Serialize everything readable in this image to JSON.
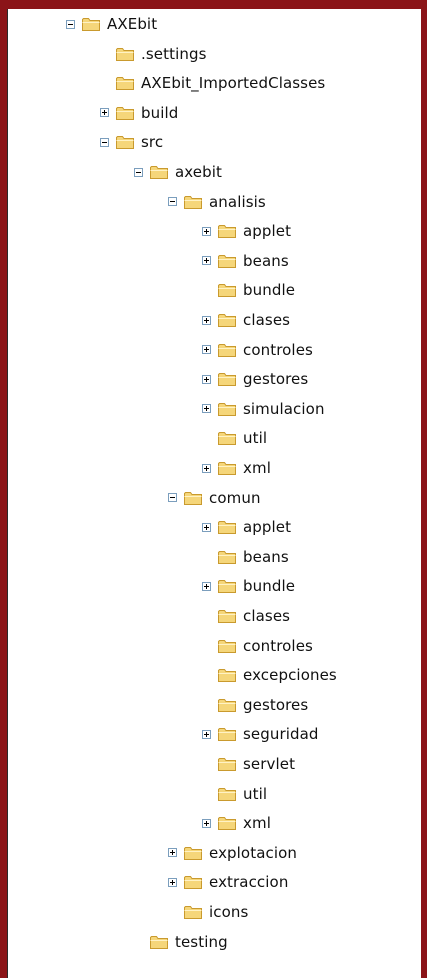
{
  "tree": {
    "nodes": [
      {
        "label": "AXEbit",
        "depth": 0,
        "toggle": "minus"
      },
      {
        "label": ".settings",
        "depth": 1,
        "toggle": "none"
      },
      {
        "label": "AXEbit_ImportedClasses",
        "depth": 1,
        "toggle": "none"
      },
      {
        "label": "build",
        "depth": 1,
        "toggle": "plus"
      },
      {
        "label": "src",
        "depth": 1,
        "toggle": "minus"
      },
      {
        "label": "axebit",
        "depth": 2,
        "toggle": "minus"
      },
      {
        "label": "analisis",
        "depth": 3,
        "toggle": "minus"
      },
      {
        "label": "applet",
        "depth": 4,
        "toggle": "plus"
      },
      {
        "label": "beans",
        "depth": 4,
        "toggle": "plus"
      },
      {
        "label": "bundle",
        "depth": 4,
        "toggle": "none"
      },
      {
        "label": "clases",
        "depth": 4,
        "toggle": "plus"
      },
      {
        "label": "controles",
        "depth": 4,
        "toggle": "plus"
      },
      {
        "label": "gestores",
        "depth": 4,
        "toggle": "plus"
      },
      {
        "label": "simulacion",
        "depth": 4,
        "toggle": "plus"
      },
      {
        "label": "util",
        "depth": 4,
        "toggle": "none"
      },
      {
        "label": "xml",
        "depth": 4,
        "toggle": "plus"
      },
      {
        "label": "comun",
        "depth": 3,
        "toggle": "minus"
      },
      {
        "label": "applet",
        "depth": 4,
        "toggle": "plus"
      },
      {
        "label": "beans",
        "depth": 4,
        "toggle": "none"
      },
      {
        "label": "bundle",
        "depth": 4,
        "toggle": "plus"
      },
      {
        "label": "clases",
        "depth": 4,
        "toggle": "none"
      },
      {
        "label": "controles",
        "depth": 4,
        "toggle": "none"
      },
      {
        "label": "excepciones",
        "depth": 4,
        "toggle": "none"
      },
      {
        "label": "gestores",
        "depth": 4,
        "toggle": "none"
      },
      {
        "label": "seguridad",
        "depth": 4,
        "toggle": "plus"
      },
      {
        "label": "servlet",
        "depth": 4,
        "toggle": "none"
      },
      {
        "label": "util",
        "depth": 4,
        "toggle": "none"
      },
      {
        "label": "xml",
        "depth": 4,
        "toggle": "plus"
      },
      {
        "label": "explotacion",
        "depth": 3,
        "toggle": "plus"
      },
      {
        "label": "extraccion",
        "depth": 3,
        "toggle": "plus"
      },
      {
        "label": "icons",
        "depth": 3,
        "toggle": "none"
      },
      {
        "label": "testing",
        "depth": 2,
        "toggle": "none"
      }
    ]
  },
  "icons": {
    "folder": "folder-icon",
    "expand": "expand-icon",
    "collapse": "collapse-icon"
  },
  "colors": {
    "frame": "#8b1418",
    "folder_fill": "#f5d67a",
    "folder_stroke": "#c99a2e",
    "toggle_border": "#7b9ebd"
  }
}
